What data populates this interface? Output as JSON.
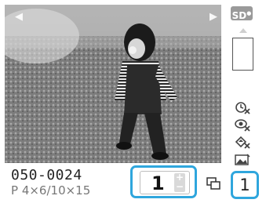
{
  "image": {
    "file_number": "050-0024",
    "paper_size": "P 4×6/10×15"
  },
  "navigation": {
    "prev_icon": "triangle-left-icon",
    "next_icon": "triangle-right-icon"
  },
  "copies": {
    "value": "1",
    "increase_symbol": "+",
    "decrease_symbol": "−"
  },
  "sidebar": {
    "media_label": "SD",
    "icons": [
      "red-eye-off-icon",
      "face-correction-off-icon",
      "print-correction-off-icon",
      "image-enhance-icon"
    ]
  },
  "total": {
    "value": "1"
  },
  "colors": {
    "highlight": "#2fa6dd",
    "badge": "#9a9a9a"
  }
}
